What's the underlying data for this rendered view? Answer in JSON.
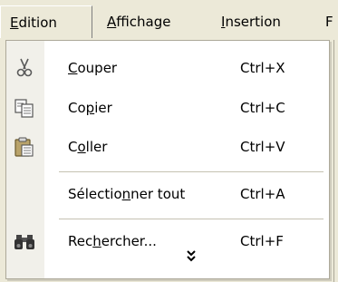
{
  "menubar": {
    "items": [
      {
        "label_pre": "",
        "label_ul": "E",
        "label_post": "dition",
        "active": true
      },
      {
        "label_pre": "",
        "label_ul": "A",
        "label_post": "ffichage",
        "active": false
      },
      {
        "label_pre": "",
        "label_ul": "I",
        "label_post": "nsertion",
        "active": false
      },
      {
        "label_pre": "",
        "label_ul": "F",
        "label_post": "",
        "active": false
      }
    ]
  },
  "menu": {
    "items": [
      {
        "pre": "",
        "ul": "C",
        "post": "ouper",
        "shortcut": "Ctrl+X",
        "icon": "scissors-icon"
      },
      {
        "pre": "Co",
        "ul": "p",
        "post": "ier",
        "shortcut": "Ctrl+C",
        "icon": "copy-icon"
      },
      {
        "pre": "C",
        "ul": "o",
        "post": "ller",
        "shortcut": "Ctrl+V",
        "icon": "paste-icon"
      },
      {
        "pre": "Sélectio",
        "ul": "n",
        "post": "ner tout",
        "shortcut": "Ctrl+A",
        "icon": ""
      },
      {
        "pre": "Rec",
        "ul": "h",
        "post": "ercher...",
        "shortcut": "Ctrl+F",
        "icon": "binoculars-icon"
      }
    ],
    "expand_icon": "double-chevron-down-icon"
  },
  "colors": {
    "menubar_bg": "#ece9d8",
    "menu_bg": "#ffffff",
    "gutter_bg": "#f1f0ea",
    "border": "#aca899"
  }
}
